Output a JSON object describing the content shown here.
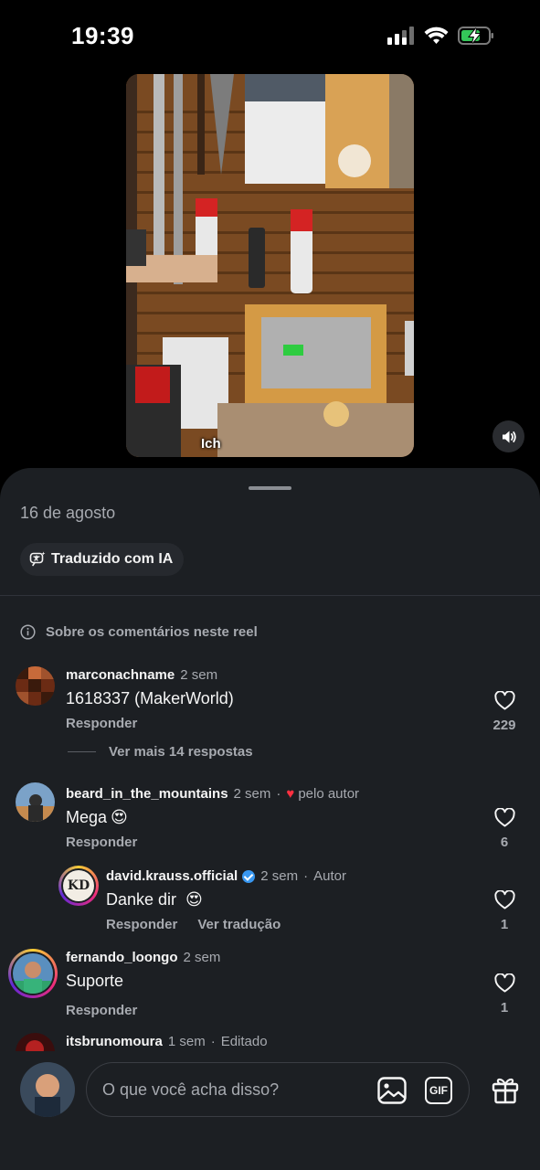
{
  "status_bar": {
    "time": "19:39",
    "icons": [
      "cellular-signal-icon",
      "wifi-icon",
      "battery-charging-icon"
    ],
    "battery_color": "#34c759"
  },
  "video": {
    "caption": "Ich",
    "mute_icon": "speaker-icon"
  },
  "sheet": {
    "date": "16 de agosto",
    "ai_chip_label": "Traduzido com IA",
    "about_comments": "Sobre os comentários neste reel"
  },
  "comments": [
    {
      "username": "marconachname",
      "time": "2 sem",
      "text": "1618337 (MakerWorld)",
      "reply_label": "Responder",
      "likes": "229",
      "more_replies": "Ver mais 14 respostas"
    },
    {
      "username": "beard_in_the_mountains",
      "time": "2 sem",
      "separator": "·",
      "liked_by_author": "pelo autor",
      "text": "Mega",
      "emoji": "😍",
      "reply_label": "Responder",
      "likes": "6",
      "reply": {
        "username": "david.krauss.official",
        "time": "2 sem",
        "separator": "·",
        "role": "Autor",
        "text": "Danke dir",
        "emoji": "😍",
        "reply_label": "Responder",
        "translate_label": "Ver tradução",
        "likes": "1",
        "avatar_text": "KD"
      }
    },
    {
      "username": "fernando_loongo",
      "time": "2 sem",
      "text": "Suporte",
      "reply_label": "Responder",
      "likes": "1"
    },
    {
      "username": "itsbrunomoura",
      "time": "1 sem",
      "separator": "·",
      "edited": "Editado"
    }
  ],
  "composer": {
    "placeholder": "O que você acha disso?",
    "gif_label": "GIF"
  },
  "colors": {
    "sheet_bg": "#1c1f23",
    "secondary_text": "#a7aab0",
    "heart_red": "#ff3040",
    "verified_blue": "#3897f0"
  }
}
